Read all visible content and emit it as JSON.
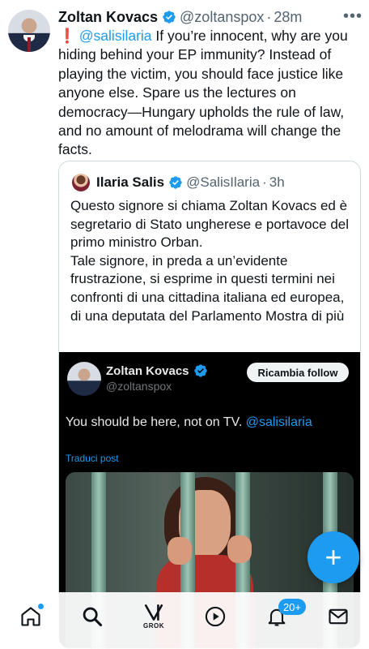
{
  "tweet": {
    "display_name": "Zoltan Kovacs",
    "handle": "@zoltanspox",
    "separator": "·",
    "time": "28m",
    "more": "•••",
    "exclamation": "❗",
    "mention": "@salisilaria",
    "body": " If you’re innocent, why are you hiding behind your EP immunity? Instead of playing the victim, you should face justice like anyone else. Spare us the lectures on democracy—Hungary upholds the rule of law, and no amount of melodrama will change the facts."
  },
  "quote": {
    "display_name": "Ilaria Salis",
    "handle": "@SalisIlaria",
    "separator": "·",
    "time": "3h",
    "text_line1": "Questo signore si chiama Zoltan Kovacs ed è segretario di Stato ungherese e portavoce del primo ministro Orban.",
    "text_line2": "Tale signore, in preda a un’evidente frustrazione, si esprime in questi termini nei confronti di una cittadina italiana ed europea, di una deputata del Parlamento ",
    "show_more": "Mostra di più"
  },
  "embed": {
    "display_name": "Zoltan Kovacs",
    "handle": "@zoltanspox",
    "follow_label": "Ricambia follow",
    "text": "You should be here, not on TV. ",
    "mention": "@salisilaria",
    "translate": "Traduci post"
  },
  "fab": {
    "label": "+"
  },
  "nav": {
    "grok_label": "GROK",
    "notif_count": "20+"
  },
  "colors": {
    "accent": "#1d9bf0",
    "text": "#0f1419",
    "muted": "#536471"
  }
}
